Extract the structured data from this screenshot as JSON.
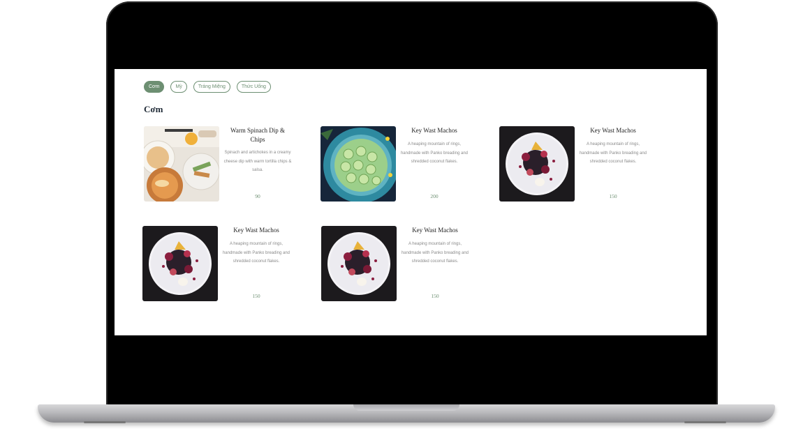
{
  "tabs": [
    {
      "label": "Cơm",
      "active": true
    },
    {
      "label": "Mỳ",
      "active": false
    },
    {
      "label": "Tráng Miệng",
      "active": false
    },
    {
      "label": "Thức Uống",
      "active": false
    }
  ],
  "section_title": "Cơm",
  "items": [
    {
      "title": "Warm Spinach Dip & Chips",
      "description": "Spinach and artichokes in a creamy cheese dip with warm tortilla chips & salsa.",
      "price": "90",
      "image": "spinach-dip-photo"
    },
    {
      "title": "Key Wast Machos",
      "description": "A heaping mountain of rings, handmade with Panko breading and shredded coconut flakes.",
      "price": "200",
      "image": "cucumber-salad-photo"
    },
    {
      "title": "Key Wast Machos",
      "description": "A heaping mountain of rings, handmade with Panko breading and shredded coconut flakes.",
      "price": "150",
      "image": "plated-dish-photo"
    },
    {
      "title": "Key Wast Machos",
      "description": "A heaping mountain of rings, handmade with Panko breading and shredded coconut flakes.",
      "price": "150",
      "image": "plated-dish-photo"
    },
    {
      "title": "Key Wast Machos",
      "description": "A heaping mountain of rings, handmade with Panko breading and shredded coconut flakes.",
      "price": "150",
      "image": "plated-dish-photo"
    }
  ],
  "colors": {
    "accent": "#6d8f72",
    "heading": "#1f2a36",
    "frame": "#000000"
  }
}
